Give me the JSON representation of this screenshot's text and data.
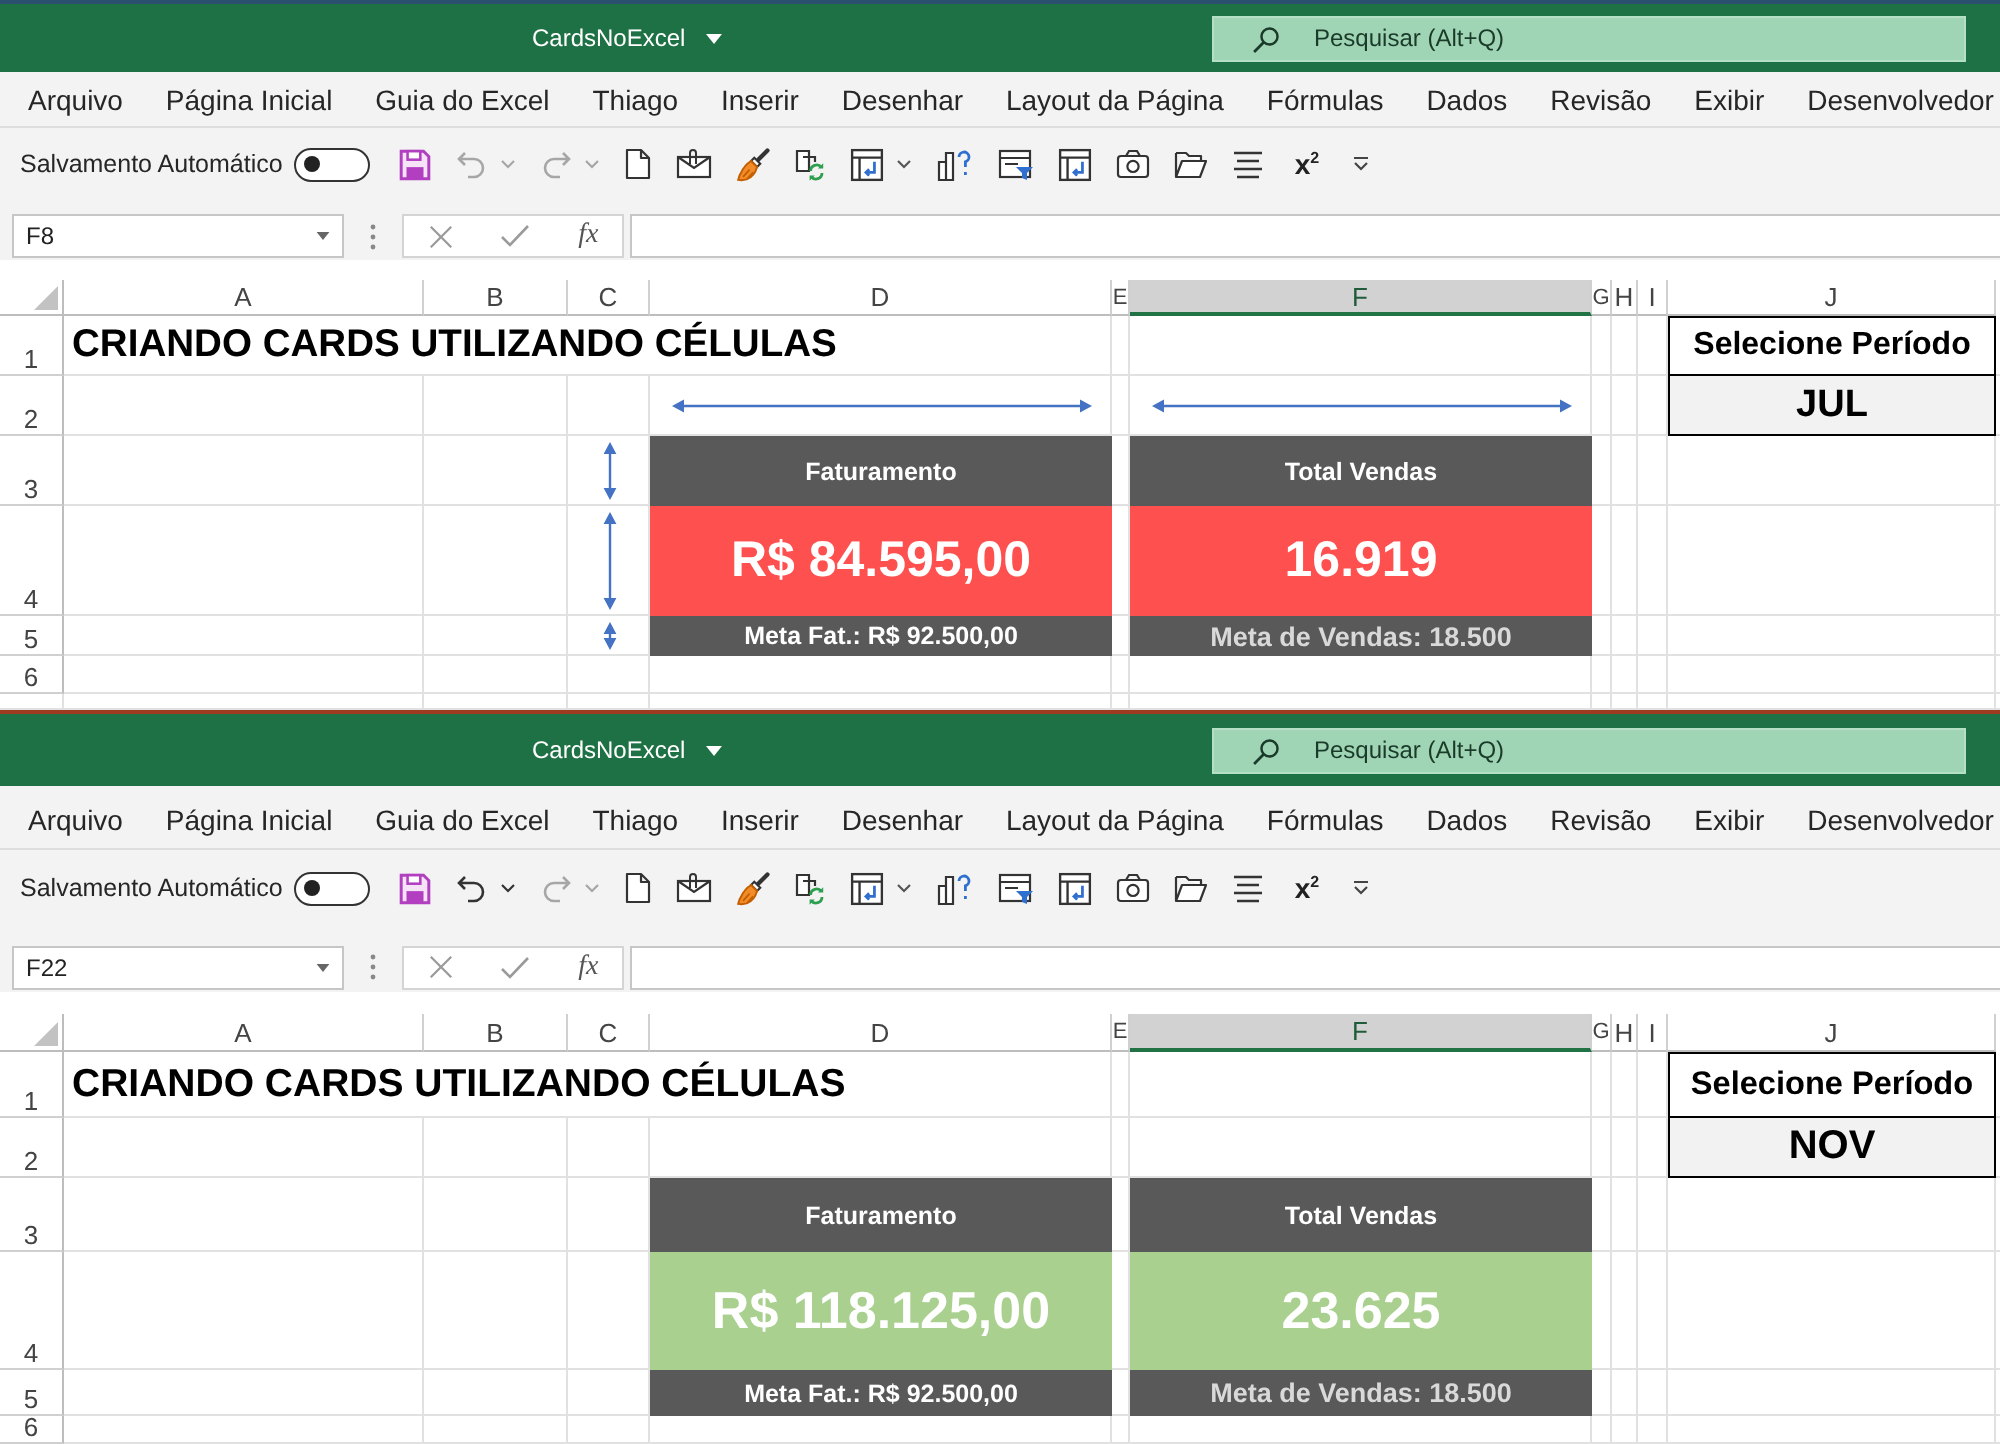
{
  "windows": [
    {
      "title": "CardsNoExcel",
      "search": {
        "placeholder": "Pesquisar (Alt+Q)"
      },
      "ribbon_tabs": [
        "Arquivo",
        "Página Inicial",
        "Guia do Excel",
        "Thiago",
        "Inserir",
        "Desenhar",
        "Layout da Página",
        "Fórmulas",
        "Dados",
        "Revisão",
        "Exibir",
        "Desenvolvedor"
      ],
      "quick_access": {
        "autosave_label": "Salvamento Automático",
        "autosave_on": false,
        "undo_enabled": false,
        "redo_enabled": false,
        "superscript": "x$^{2}$"
      },
      "formula_bar": {
        "name_box": "F8",
        "function_label": "fx"
      },
      "sheet": {
        "columns": [
          {
            "label": "A",
            "selected": false
          },
          {
            "label": "B",
            "selected": false
          },
          {
            "label": "C",
            "selected": false
          },
          {
            "label": "D",
            "selected": false
          },
          {
            "label": "E",
            "selected": false
          },
          {
            "label": "F",
            "selected": true
          },
          {
            "label": "G",
            "selected": false
          },
          {
            "label": "H",
            "selected": false
          },
          {
            "label": "I",
            "selected": false
          },
          {
            "label": "J",
            "selected": false
          }
        ],
        "rows": [
          "1",
          "2",
          "3",
          "4",
          "5",
          "6"
        ],
        "title": "CRIANDO CARDS UTILIZANDO CÉLULAS",
        "period_label": "Selecione Período",
        "period_value": "JUL",
        "guide_arrows": true,
        "cards": [
          {
            "title": "Faturamento",
            "value": "R$ 84.595,00",
            "goal": "Meta Fat.: R$ 92.500,00",
            "goal_met": false
          },
          {
            "title": "Total Vendas",
            "value": "16.919",
            "goal": "Meta de Vendas: 18.500",
            "goal_met": false
          }
        ]
      }
    },
    {
      "title": "CardsNoExcel",
      "search": {
        "placeholder": "Pesquisar (Alt+Q)"
      },
      "ribbon_tabs": [
        "Arquivo",
        "Página Inicial",
        "Guia do Excel",
        "Thiago",
        "Inserir",
        "Desenhar",
        "Layout da Página",
        "Fórmulas",
        "Dados",
        "Revisão",
        "Exibir",
        "Desenvolvedor"
      ],
      "quick_access": {
        "autosave_label": "Salvamento Automático",
        "autosave_on": false,
        "undo_enabled": true,
        "redo_enabled": false,
        "superscript": "x$^{2}$"
      },
      "formula_bar": {
        "name_box": "F22",
        "function_label": "fx"
      },
      "sheet": {
        "columns": [
          {
            "label": "A",
            "selected": false
          },
          {
            "label": "B",
            "selected": false
          },
          {
            "label": "C",
            "selected": false
          },
          {
            "label": "D",
            "selected": false
          },
          {
            "label": "E",
            "selected": false
          },
          {
            "label": "F",
            "selected": true
          },
          {
            "label": "G",
            "selected": false
          },
          {
            "label": "H",
            "selected": false
          },
          {
            "label": "I",
            "selected": false
          },
          {
            "label": "J",
            "selected": false
          }
        ],
        "rows": [
          "1",
          "2",
          "3",
          "4",
          "5",
          "6"
        ],
        "title": "CRIANDO CARDS UTILIZANDO CÉLULAS",
        "period_label": "Selecione Período",
        "period_value": "NOV",
        "guide_arrows": false,
        "cards": [
          {
            "title": "Faturamento",
            "value": "R$ 118.125,00",
            "goal": "Meta Fat.: R$ 92.500,00",
            "goal_met": true
          },
          {
            "title": "Total Vendas",
            "value": "23.625",
            "goal": "Meta de Vendas: 18.500",
            "goal_met": true
          }
        ]
      }
    }
  ]
}
